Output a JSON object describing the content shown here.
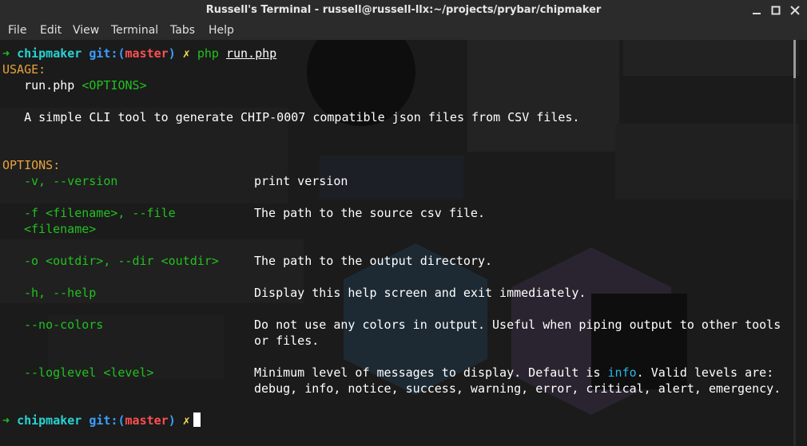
{
  "window": {
    "title": "Russell's Terminal - russell@russell-llx:~/projects/prybar/chipmaker"
  },
  "menu": {
    "items": [
      "File",
      "Edit",
      "View",
      "Terminal",
      "Tabs",
      "Help"
    ]
  },
  "prompt": {
    "arrow": "➜",
    "dir": "chipmaker",
    "git_prefix": "git:(",
    "branch": "master",
    "git_suffix": ")",
    "dirty": "✗",
    "command_name": "php",
    "command_arg": "run.php"
  },
  "usage": {
    "header": "USAGE:",
    "script": "run.php",
    "options_token": "<OPTIONS>",
    "description": "A simple CLI tool to generate CHIP-0007 compatible json files from CSV files."
  },
  "options": {
    "header": "OPTIONS:",
    "version": {
      "name": "-v, --version",
      "desc": "print version"
    },
    "file": {
      "name": "-f <filename>, --file",
      "name2": "<filename>",
      "desc": "The path to the source csv file."
    },
    "dir": {
      "name": "-o <outdir>, --dir <outdir>",
      "desc": "The path to the output directory."
    },
    "help": {
      "name": "-h, --help",
      "desc": "Display this help screen and exit immediately."
    },
    "nocolors": {
      "name": "--no-colors",
      "desc": "Do not use any colors in output. Useful when piping output to other tools",
      "desc2": "or files."
    },
    "loglevel": {
      "name": "--loglevel <level>",
      "desc_pre": "Minimum level of messages to display. Default is ",
      "desc_default": "info",
      "desc_post": ". Valid levels are:",
      "desc2": "debug, info, notice, success, warning, error, critical, alert, emergency."
    }
  },
  "colors": {
    "arrow": "#21c11f",
    "dir": "#27d3d3",
    "git": "#3b9eff",
    "branch": "#ff4f4f",
    "dirty": "#ffe14a",
    "section_header": "#e8a23d",
    "option": "#21c11f",
    "info_highlight": "#28b8e8"
  }
}
